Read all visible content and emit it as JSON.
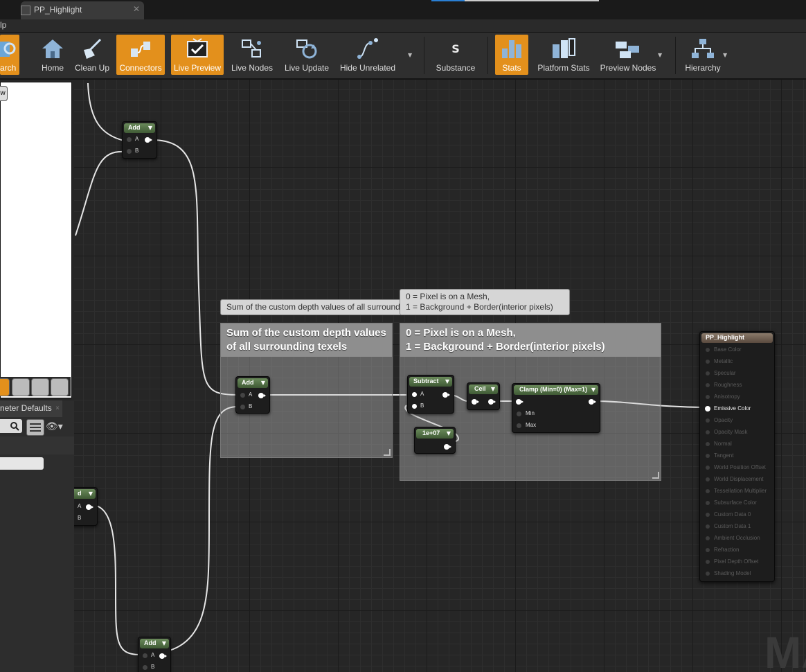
{
  "tab": {
    "title": "PP_Highlight"
  },
  "menu": {
    "partial_item": "lp"
  },
  "progress": {
    "fraction": 0.2
  },
  "toolbar": {
    "search_label": "arch",
    "home": "Home",
    "clean_up": "Clean Up",
    "connectors": "Connectors",
    "live_preview": "Live Preview",
    "live_nodes": "Live Nodes",
    "live_update": "Live Update",
    "hide_unrelated": "Hide Unrelated",
    "substance": "Substance",
    "stats": "Stats",
    "platform_stats": "Platform Stats",
    "preview_nodes": "Preview Nodes",
    "hierarchy": "Hierarchy",
    "accent_color": "#e3901c"
  },
  "left_panel": {
    "viewport_button": "w",
    "details_tab": "neter Defaults",
    "close": "×"
  },
  "comments": {
    "sum": {
      "title": "Sum of the custom depth values of all surrounding texels",
      "bubble": "Sum of the custom depth values of all surrounding texels"
    },
    "mask": {
      "title_line1": "0 = Pixel is on a Mesh,",
      "title_line2": "1 = Background + Border(interior pixels)",
      "bubble_line1": "0 = Pixel is on a Mesh,",
      "bubble_line2": "1 = Background + Border(interior pixels)"
    }
  },
  "nodes": {
    "add_top": {
      "title": "Add",
      "pin_a": "A",
      "pin_b": "B"
    },
    "add_middle": {
      "title": "Add",
      "pin_a": "A",
      "pin_b": "B"
    },
    "add_left_partial": {
      "title": "d",
      "pin_a": "A",
      "pin_b": "B"
    },
    "add_bottom": {
      "title": "Add",
      "pin_a": "A",
      "pin_b": "B"
    },
    "subtract": {
      "title": "Subtract",
      "pin_a": "A",
      "pin_b": "B"
    },
    "constant": {
      "title": "1e+07"
    },
    "ceil": {
      "title": "Ceil"
    },
    "clamp": {
      "title": "Clamp (Min=0) (Max=1)",
      "pin_min": "Min",
      "pin_max": "Max"
    }
  },
  "result_node": {
    "title": "PP_Highlight",
    "inputs": [
      {
        "label": "Base Color",
        "active": false
      },
      {
        "label": "Metallic",
        "active": false
      },
      {
        "label": "Specular",
        "active": false
      },
      {
        "label": "Roughness",
        "active": false
      },
      {
        "label": "Anisotropy",
        "active": false
      },
      {
        "label": "Emissive Color",
        "active": true
      },
      {
        "label": "Opacity",
        "active": false
      },
      {
        "label": "Opacity Mask",
        "active": false
      },
      {
        "label": "Normal",
        "active": false
      },
      {
        "label": "Tangent",
        "active": false
      },
      {
        "label": "World Position Offset",
        "active": false
      },
      {
        "label": "World Displacement",
        "active": false
      },
      {
        "label": "Tessellation Multiplier",
        "active": false
      },
      {
        "label": "Subsurface Color",
        "active": false
      },
      {
        "label": "Custom Data 0",
        "active": false
      },
      {
        "label": "Custom Data 1",
        "active": false
      },
      {
        "label": "Ambient Occlusion",
        "active": false
      },
      {
        "label": "Refraction",
        "active": false
      },
      {
        "label": "Pixel Depth Offset",
        "active": false
      },
      {
        "label": "Shading Model",
        "active": false
      }
    ]
  },
  "watermark": "MA"
}
